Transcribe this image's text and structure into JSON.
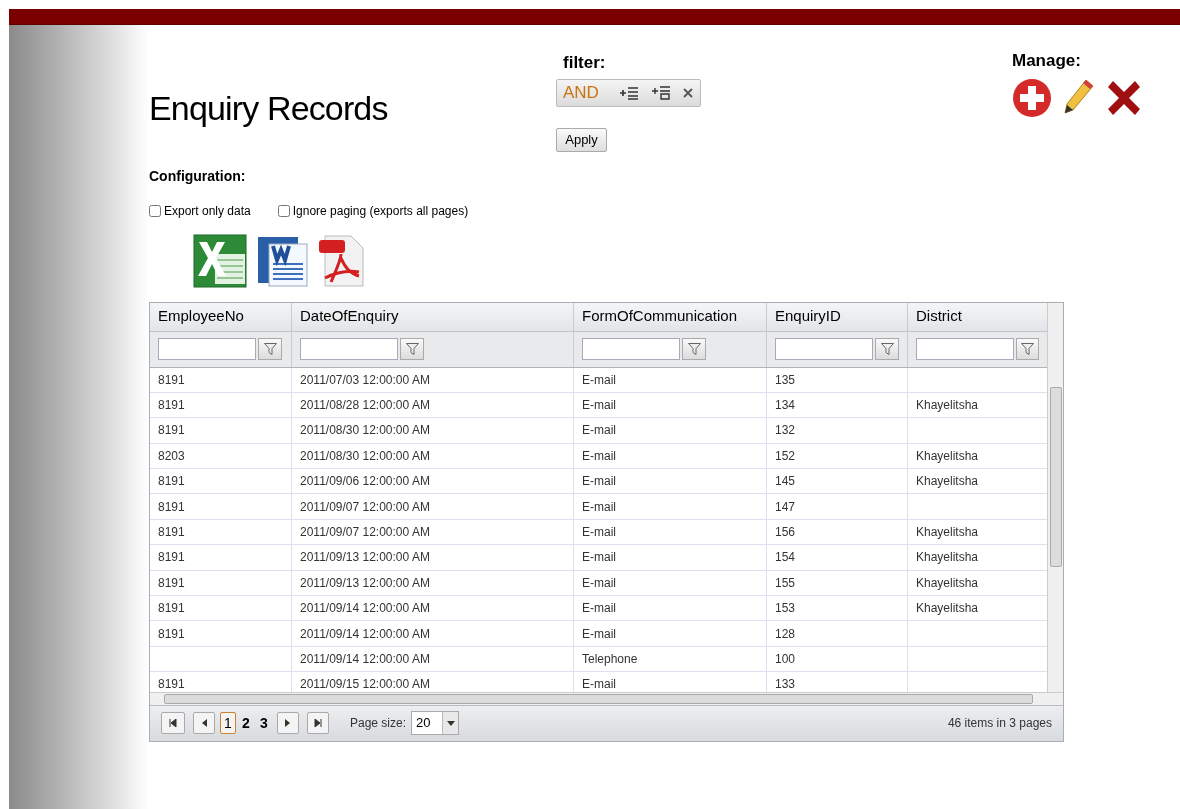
{
  "title": "Enquiry Records",
  "filter": {
    "label": "filter:",
    "operator": "AND",
    "apply": "Apply"
  },
  "manage": {
    "label": "Manage:"
  },
  "configuration": {
    "label": "Configuration:",
    "options": [
      {
        "label": "Export only data",
        "checked": false
      },
      {
        "label": "Ignore paging (exports all pages)",
        "checked": false
      }
    ]
  },
  "table": {
    "columns": [
      "EmployeeNo",
      "DateOfEnquiry",
      "FormOfCommunication",
      "EnquiryID",
      "District"
    ],
    "rows": [
      [
        "8191",
        "2011/07/03 12:00:00 AM",
        "E-mail",
        "135",
        ""
      ],
      [
        "8191",
        "2011/08/28 12:00:00 AM",
        "E-mail",
        "134",
        "Khayelitsha"
      ],
      [
        "8191",
        "2011/08/30 12:00:00 AM",
        "E-mail",
        "132",
        ""
      ],
      [
        "8203",
        "2011/08/30 12:00:00 AM",
        "E-mail",
        "152",
        "Khayelitsha"
      ],
      [
        "8191",
        "2011/09/06 12:00:00 AM",
        "E-mail",
        "145",
        "Khayelitsha"
      ],
      [
        "8191",
        "2011/09/07 12:00:00 AM",
        "E-mail",
        "147",
        ""
      ],
      [
        "8191",
        "2011/09/07 12:00:00 AM",
        "E-mail",
        "156",
        "Khayelitsha"
      ],
      [
        "8191",
        "2011/09/13 12:00:00 AM",
        "E-mail",
        "154",
        "Khayelitsha"
      ],
      [
        "8191",
        "2011/09/13 12:00:00 AM",
        "E-mail",
        "155",
        "Khayelitsha"
      ],
      [
        "8191",
        "2011/09/14 12:00:00 AM",
        "E-mail",
        "153",
        "Khayelitsha"
      ],
      [
        "8191",
        "2011/09/14 12:00:00 AM",
        "E-mail",
        "128",
        ""
      ],
      [
        "",
        "2011/09/14 12:00:00 AM",
        "Telephone",
        "100",
        ""
      ],
      [
        "8191",
        "2011/09/15 12:00:00 AM",
        "E-mail",
        "133",
        ""
      ]
    ]
  },
  "pager": {
    "pages": [
      {
        "label": "1",
        "selected": true
      },
      {
        "label": "2",
        "selected": false
      },
      {
        "label": "3",
        "selected": false
      }
    ],
    "page_size_label": "Page size:",
    "page_size": "20",
    "summary": "46 items in 3 pages"
  }
}
